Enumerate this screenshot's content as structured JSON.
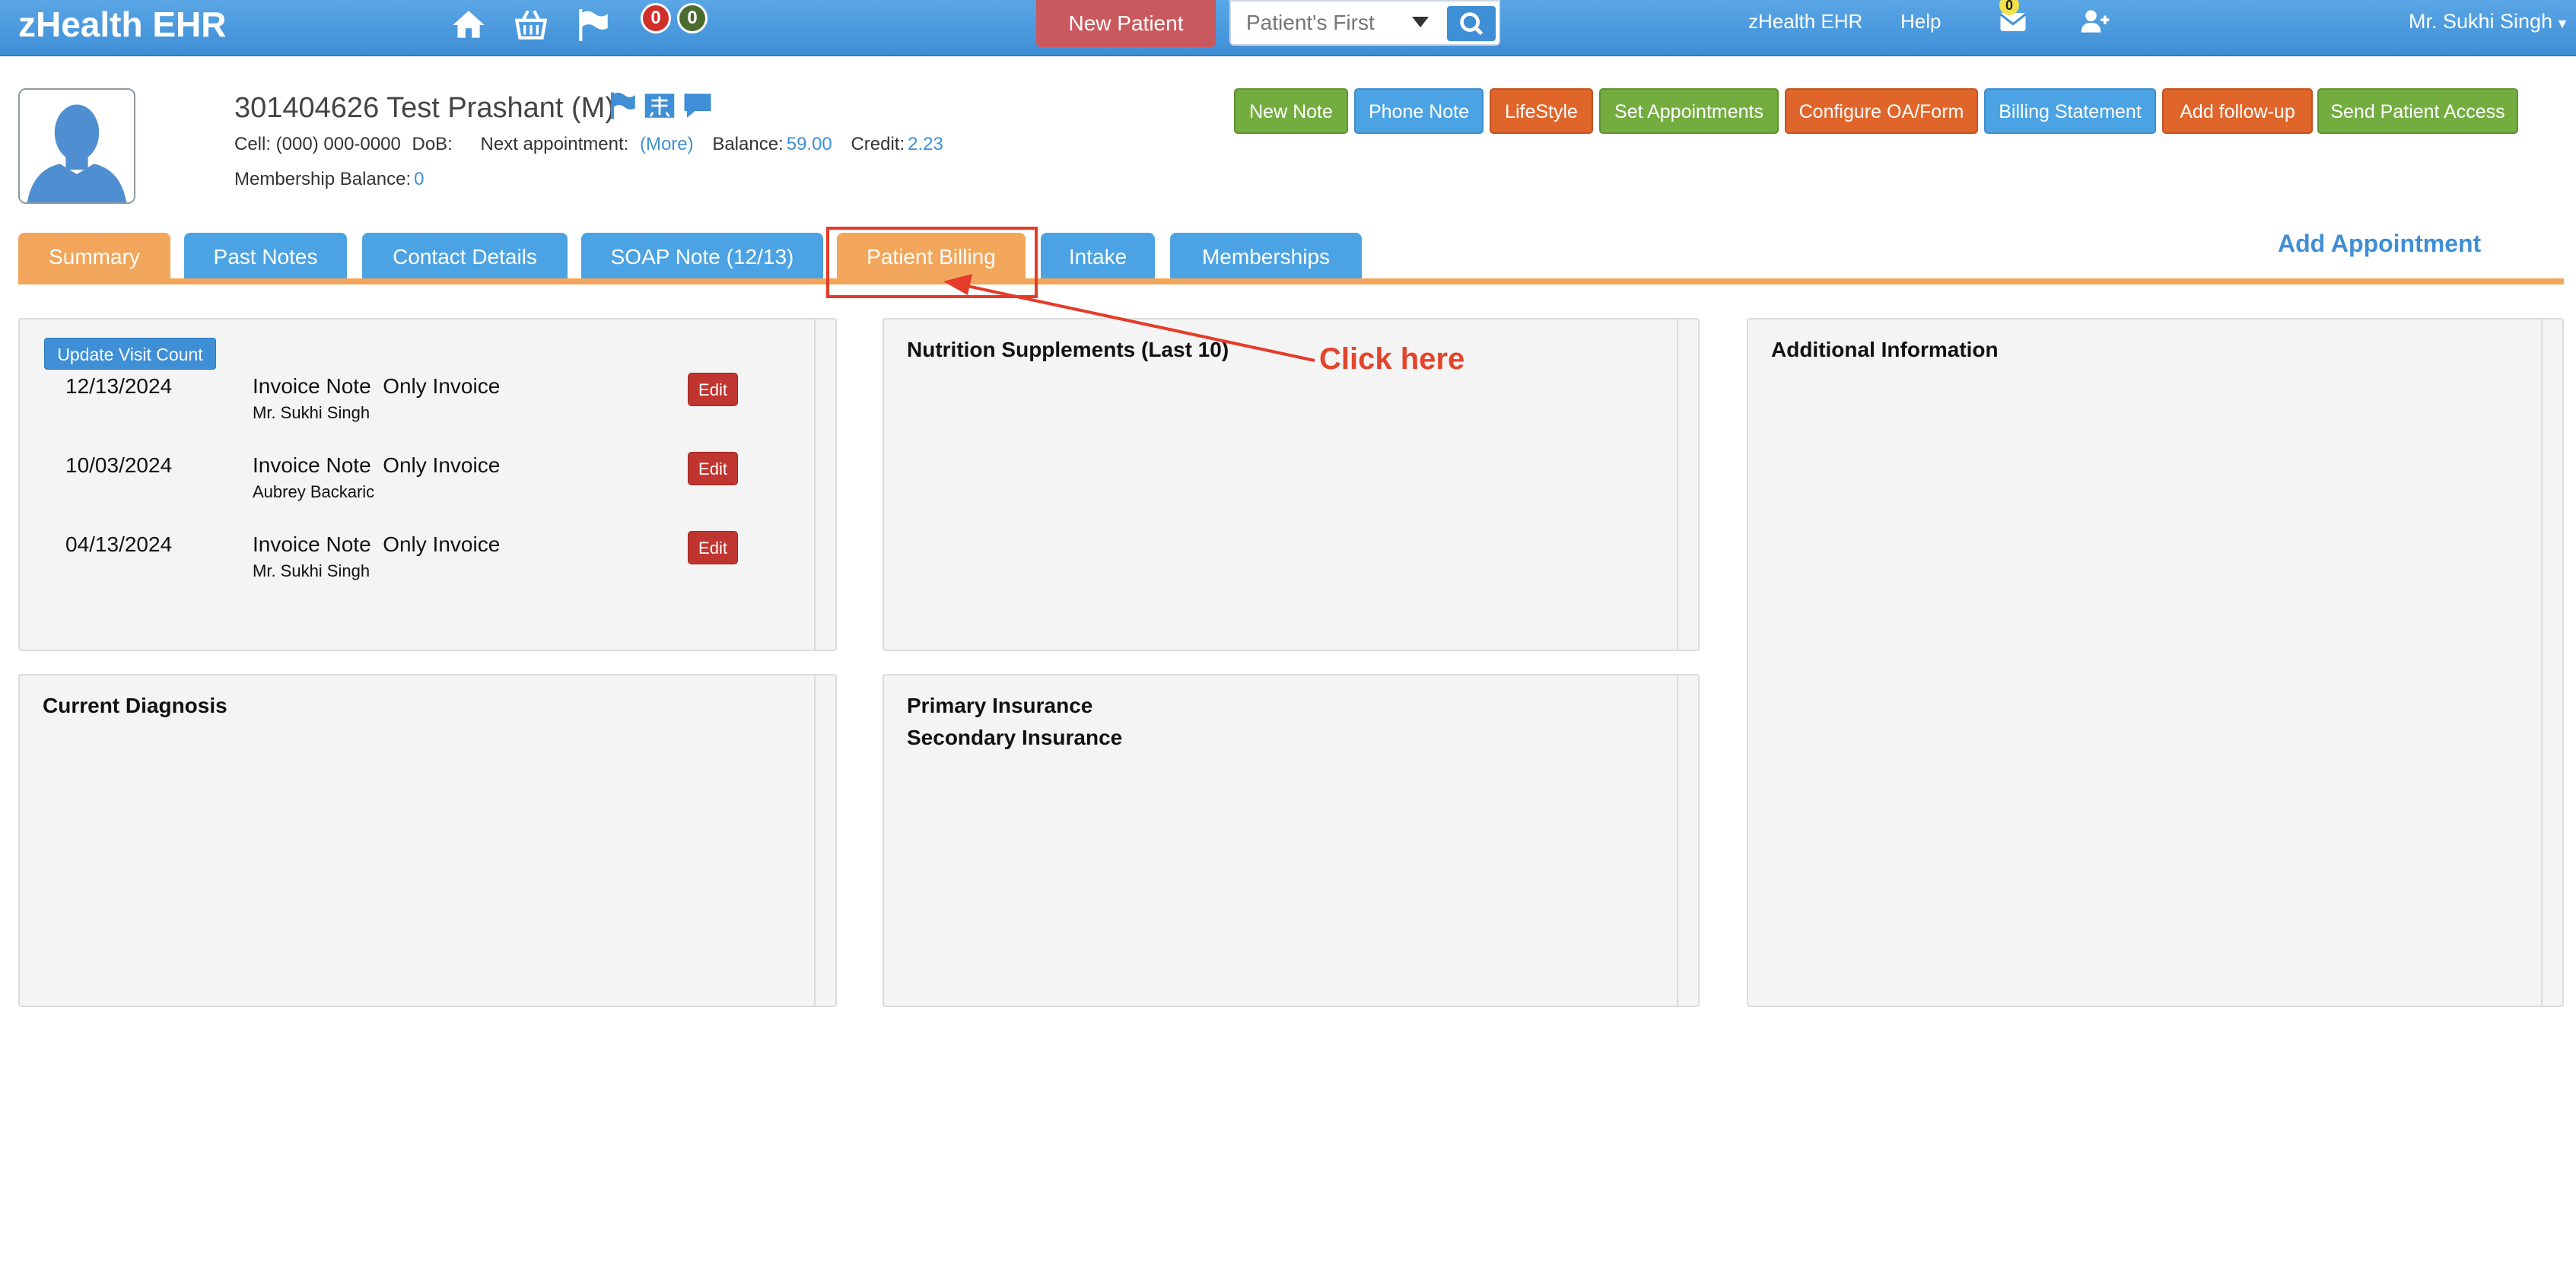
{
  "topbar": {
    "brand": "zHealth EHR",
    "badges": [
      "0",
      "0"
    ],
    "new_patient_label": "New Patient",
    "search_placeholder": "Patient's First",
    "links": [
      "zHealth EHR",
      "Help"
    ],
    "mail_count": "0",
    "user_menu": "Mr. Sukhi Singh"
  },
  "patient": {
    "title": "301404626 Test Prashant (M)",
    "cell_label": "Cell: (000) 000-0000",
    "dob_label": "DoB:",
    "next_appt_label": "Next appointment:",
    "more_link": "(More)",
    "balance_label": "Balance:",
    "balance_value": "59.00",
    "credit_label": "Credit:",
    "credit_value": "2.23",
    "membership_label": "Membership Balance:",
    "membership_value": "0"
  },
  "actions": [
    {
      "label": "New Note",
      "color": "#73ad3f"
    },
    {
      "label": "Phone Note",
      "color": "#4ba3e3"
    },
    {
      "label": "LifeStyle",
      "color": "#e0652b"
    },
    {
      "label": "Set Appointments",
      "color": "#73ad3f"
    },
    {
      "label": "Configure OA/Form",
      "color": "#e0652b"
    },
    {
      "label": "Billing Statement",
      "color": "#4ba3e3"
    },
    {
      "label": "Add follow-up",
      "color": "#e0652b"
    },
    {
      "label": "Send Patient Access",
      "color": "#73ad3f"
    }
  ],
  "tabs": [
    {
      "label": "Summary",
      "active": true
    },
    {
      "label": "Past Notes"
    },
    {
      "label": "Contact Details"
    },
    {
      "label": "SOAP Note (12/13)"
    },
    {
      "label": "Patient Billing"
    },
    {
      "label": "Intake"
    },
    {
      "label": "Memberships"
    }
  ],
  "add_appointment": "Add Appointment",
  "visits": {
    "update_label": "Update Visit Count",
    "edit_label": "Edit",
    "rows": [
      {
        "date": "12/13/2024",
        "note": "Invoice Note  Only Invoice",
        "author": "Mr. Sukhi Singh"
      },
      {
        "date": "10/03/2024",
        "note": "Invoice Note  Only Invoice",
        "author": "Aubrey Backaric"
      },
      {
        "date": "04/13/2024",
        "note": "Invoice Note  Only Invoice",
        "author": "Mr. Sukhi Singh"
      }
    ]
  },
  "panels": {
    "nutrition": "Nutrition Supplements (Last 10)",
    "additional": "Additional Information",
    "diagnosis": "Current Diagnosis",
    "primary_ins": "Primary Insurance",
    "secondary_ins": "Secondary Insurance"
  },
  "annotation": {
    "text": "Click here",
    "color": "#e53b2a"
  }
}
